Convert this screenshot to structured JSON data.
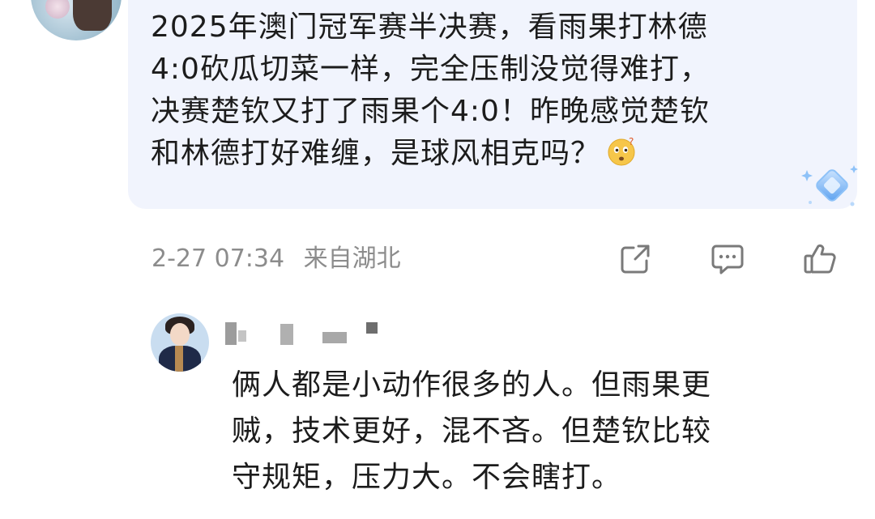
{
  "post": {
    "text_lines": [
      "2025年澳门冠军赛半决赛，看雨果打林德",
      "4:0砍瓜切菜一样，完全压制没觉得难打，",
      "决赛楚钦又打了雨果个4:0！昨晚感觉楚钦",
      "和林德打好难缠，是球风相克吗？"
    ],
    "emoji_icon": "thinking-face-emoji",
    "badge_icon": "sparkle-diamond-badge"
  },
  "meta": {
    "date": "2-27 07:34",
    "location": "来自湖北"
  },
  "actions": {
    "share_icon": "share-icon",
    "comment_icon": "comment-icon",
    "like_icon": "thumbs-up-icon"
  },
  "reply": {
    "avatar_icon": "user-avatar",
    "text_lines": [
      "俩人都是小动作很多的人。但雨果更",
      "贼，技术更好，混不吝。但楚钦比较",
      "守规矩，压力大。不会瞎打。"
    ]
  },
  "colors": {
    "bubble_bg": "#f1f4fd",
    "text": "#1c1c1c",
    "meta_text": "#8c8c8c",
    "icon_stroke": "#7a7a7a"
  }
}
